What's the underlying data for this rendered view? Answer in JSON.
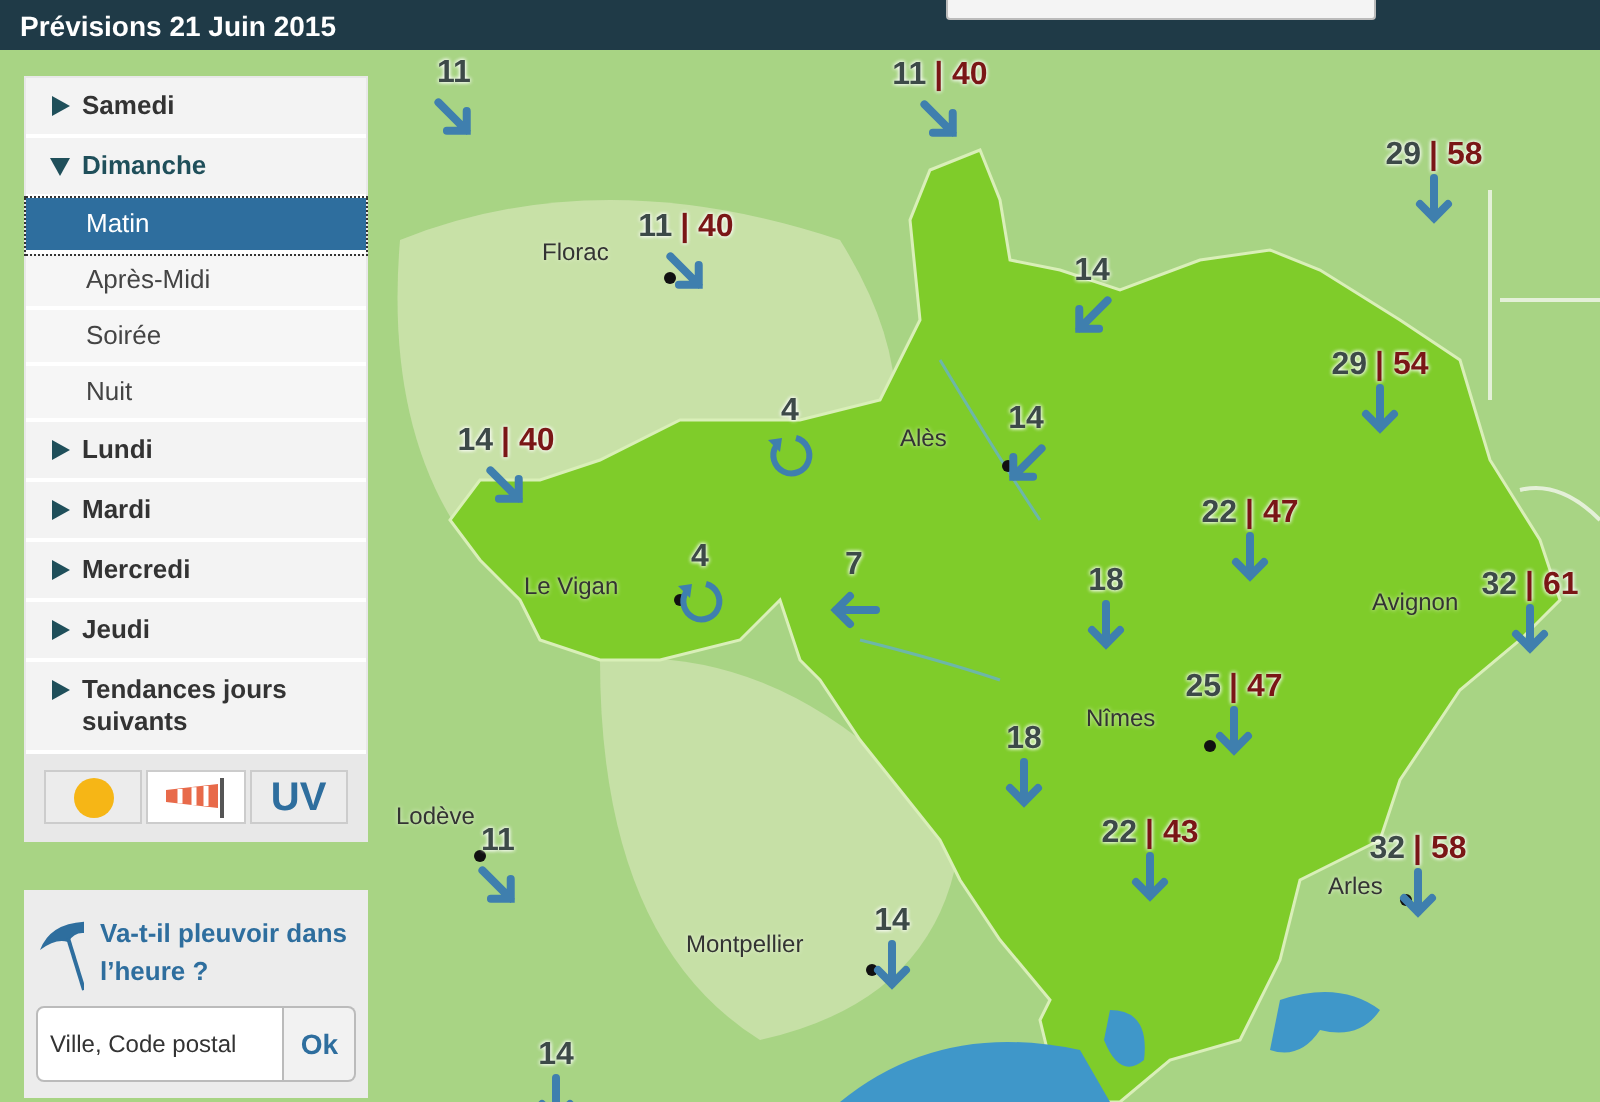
{
  "header": {
    "title": "Prévisions 21 Juin 2015"
  },
  "sidebar": {
    "days": [
      {
        "label": "Samedi",
        "expanded": false
      },
      {
        "label": "Dimanche",
        "expanded": true,
        "slots": [
          {
            "label": "Matin",
            "selected": true
          },
          {
            "label": "Après-Midi",
            "selected": false
          },
          {
            "label": "Soirée",
            "selected": false
          },
          {
            "label": "Nuit",
            "selected": false
          }
        ]
      },
      {
        "label": "Lundi",
        "expanded": false
      },
      {
        "label": "Mardi",
        "expanded": false
      },
      {
        "label": "Mercredi",
        "expanded": false
      },
      {
        "label": "Jeudi",
        "expanded": false
      },
      {
        "label": "Tendances jours suivants",
        "expanded": false
      }
    ],
    "map_types": [
      {
        "kind": "sun",
        "selected": false
      },
      {
        "kind": "wind",
        "selected": true
      },
      {
        "kind": "uv",
        "label": "UV",
        "selected": false
      }
    ]
  },
  "rain_widget": {
    "title": "Va-t-il pleuvoir dans l’heure ?",
    "placeholder": "Ville, Code postal",
    "button": "Ok"
  },
  "map": {
    "cities": [
      "Florac",
      "Alès",
      "Le Vigan",
      "Avignon",
      "Nîmes",
      "Lodève",
      "Arles",
      "Montpellier"
    ],
    "wind": [
      {
        "speed": "11",
        "kind": "southeast"
      },
      {
        "speed": "11",
        "gust": "| 40",
        "kind": "southeast"
      },
      {
        "speed": "29",
        "gust": "| 58",
        "kind": "south"
      },
      {
        "speed": "11",
        "gust": "| 40",
        "kind": "southeast"
      },
      {
        "speed": "14",
        "kind": "southwest"
      },
      {
        "speed": "29",
        "gust": "| 54",
        "kind": "south"
      },
      {
        "speed": "4",
        "kind": "variable"
      },
      {
        "speed": "14",
        "kind": "southwest"
      },
      {
        "speed": "14",
        "gust": "| 40",
        "kind": "southeast"
      },
      {
        "speed": "22",
        "gust": "| 47",
        "kind": "south"
      },
      {
        "speed": "4",
        "kind": "variable"
      },
      {
        "speed": "7",
        "kind": "west"
      },
      {
        "speed": "18",
        "kind": "south"
      },
      {
        "speed": "32",
        "gust": "| 61",
        "kind": "south"
      },
      {
        "speed": "25",
        "gust": "| 47",
        "kind": "south"
      },
      {
        "speed": "18",
        "kind": "south"
      },
      {
        "speed": "22",
        "gust": "| 43",
        "kind": "south"
      },
      {
        "speed": "32",
        "gust": "| 58",
        "kind": "south"
      },
      {
        "speed": "11",
        "kind": "southeast"
      },
      {
        "speed": "14",
        "kind": "south"
      },
      {
        "speed": "14",
        "kind": "south"
      }
    ]
  }
}
